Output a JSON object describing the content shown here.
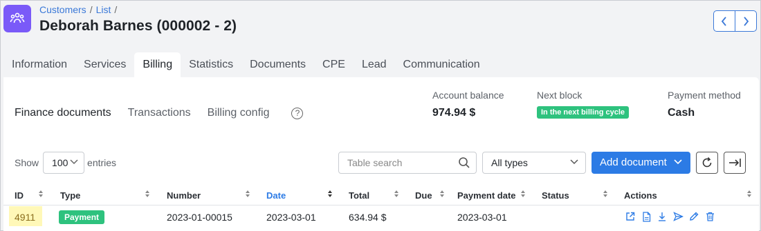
{
  "breadcrumb": {
    "items": [
      "Customers",
      "List"
    ]
  },
  "page": {
    "title": "Deborah Barnes (000002 - 2)"
  },
  "tabs": [
    "Information",
    "Services",
    "Billing",
    "Statistics",
    "Documents",
    "CPE",
    "Lead",
    "Communication"
  ],
  "active_tab": "Billing",
  "subtabs": [
    "Finance documents",
    "Transactions",
    "Billing config"
  ],
  "summary": {
    "balance_label": "Account balance",
    "balance_value": "974.94 $",
    "next_block_label": "Next block",
    "next_block_badge": "In the next billing cycle",
    "method_label": "Payment method",
    "method_value": "Cash"
  },
  "controls": {
    "show_label": "Show",
    "entries_value": "100",
    "entries_label": "entries",
    "search_placeholder": "Table search",
    "types_value": "All types",
    "add_label": "Add document"
  },
  "table": {
    "columns": [
      "ID",
      "Type",
      "Number",
      "Date",
      "Total",
      "Due",
      "Payment date",
      "Status",
      "Actions"
    ],
    "rows": [
      {
        "id": "4911",
        "type": "Payment",
        "number": "2023-01-00015",
        "date": "2023-03-01",
        "total": "634.94 $",
        "due": "",
        "payment_date": "2023-03-01",
        "status": ""
      }
    ]
  },
  "colors": {
    "accent": "#2c7be5",
    "app_icon": "#7a5af8",
    "success": "#2ec27e",
    "highlight": "#fff8b8"
  },
  "icons": [
    "customers-icon",
    "chevron-left-icon",
    "chevron-right-icon",
    "help-icon",
    "search-icon",
    "refresh-icon",
    "export-icon",
    "open-icon",
    "pdf-icon",
    "download-icon",
    "send-icon",
    "edit-icon",
    "delete-icon"
  ]
}
